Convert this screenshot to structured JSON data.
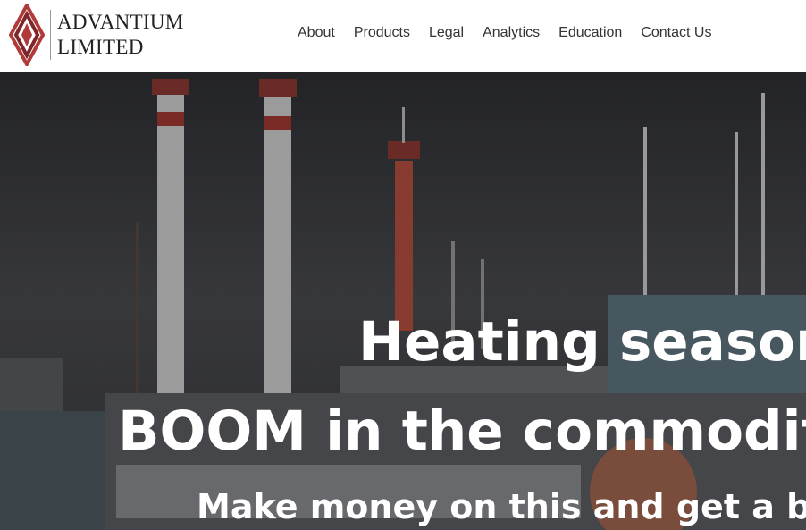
{
  "brand": {
    "line1": "ADVANTIUM",
    "line2": "LIMITED",
    "accent_color": "#b0393a"
  },
  "nav": {
    "items": [
      "About",
      "Products",
      "Legal",
      "Analytics",
      "Education",
      "Contact Us"
    ]
  },
  "hero": {
    "headline_1": "Heating season",
    "headline_2": "BOOM in the commodity",
    "subheadline": "Make money on this and get a bonus"
  }
}
